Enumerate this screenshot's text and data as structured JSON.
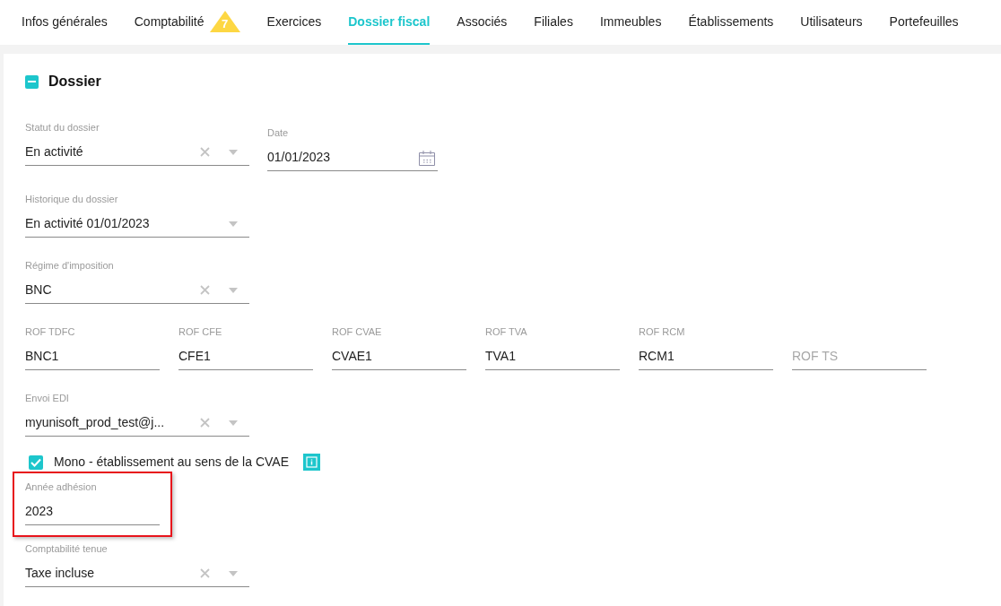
{
  "tabs": [
    {
      "label": "Infos générales",
      "selected": false
    },
    {
      "label": "Comptabilité",
      "selected": false,
      "badge": "7"
    },
    {
      "label": "Exercices",
      "selected": false
    },
    {
      "label": "Dossier fiscal",
      "selected": true
    },
    {
      "label": "Associés",
      "selected": false
    },
    {
      "label": "Filiales",
      "selected": false
    },
    {
      "label": "Immeubles",
      "selected": false
    },
    {
      "label": "Établissements",
      "selected": false
    },
    {
      "label": "Utilisateurs",
      "selected": false
    },
    {
      "label": "Portefeuilles",
      "selected": false
    }
  ],
  "section": {
    "title": "Dossier",
    "expanded": true
  },
  "status": {
    "label": "Statut du dossier",
    "value": "En activité",
    "clearable": true
  },
  "date": {
    "label": "Date",
    "value": "01/01/2023"
  },
  "history": {
    "label": "Historique du dossier",
    "value": "En activité 01/01/2023",
    "clearable": false
  },
  "regime": {
    "label": "Régime d'imposition",
    "value": "BNC",
    "clearable": true
  },
  "rof": [
    {
      "label": "ROF TDFC",
      "value": "BNC1"
    },
    {
      "label": "ROF CFE",
      "value": "CFE1"
    },
    {
      "label": "ROF CVAE",
      "value": "CVAE1"
    },
    {
      "label": "ROF TVA",
      "value": "TVA1"
    },
    {
      "label": "ROF RCM",
      "value": "RCM1"
    },
    {
      "placeholder": "ROF TS"
    }
  ],
  "edi": {
    "label": "Envoi EDI",
    "value": "myunisoft_prod_test@j...",
    "clearable": true
  },
  "mono": {
    "label": "Mono - établissement au sens de la CVAE",
    "checked": true
  },
  "adhesion": {
    "label": "Année adhésion",
    "value": "2023",
    "highlighted": true
  },
  "tenue": {
    "label": "Comptabilité tenue",
    "value": "Taxe incluse",
    "clearable": true
  }
}
